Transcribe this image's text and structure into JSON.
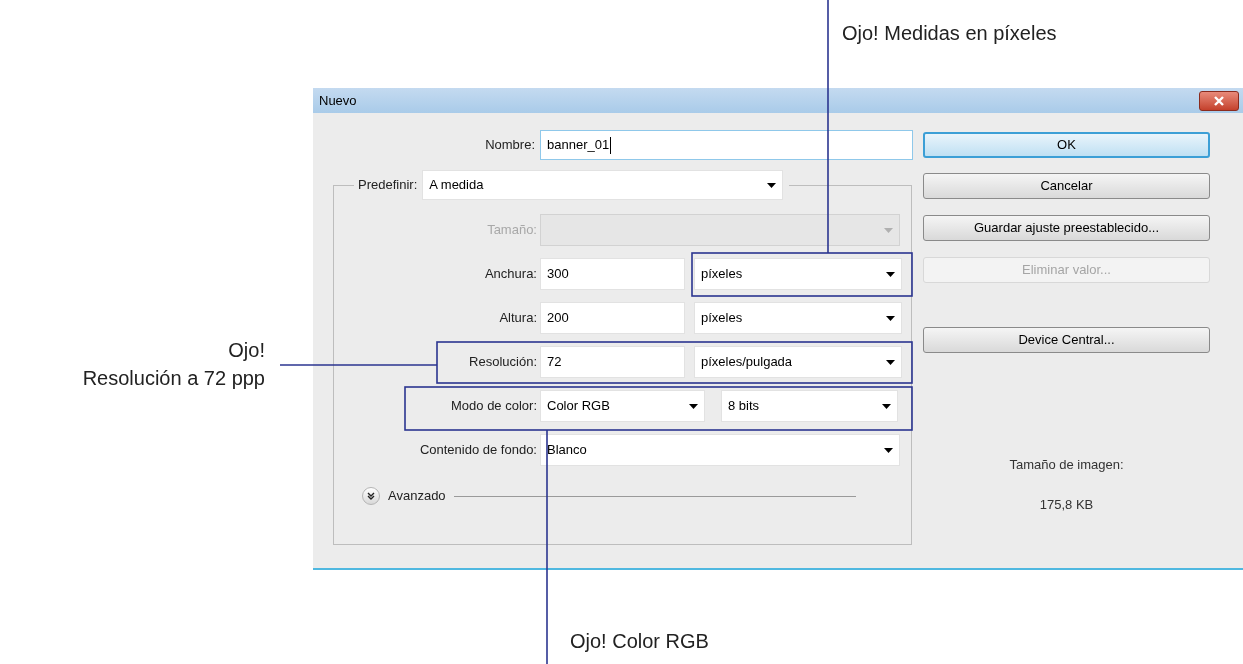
{
  "annotations": [
    {
      "text": "Ojo! Medidas en píxeles"
    },
    {
      "text": "Ojo!\nResolución a 72 ppp"
    },
    {
      "text": "Ojo! Color RGB"
    }
  ],
  "dialog": {
    "title": "Nuevo",
    "name_field": {
      "label": "Nombre:",
      "value": "banner_01",
      "focused": true
    },
    "preset": {
      "label": "Predefinir:",
      "value": "A medida"
    },
    "rows": [
      {
        "kind": "wide",
        "label": "Tamaño:",
        "disabled": true,
        "fields": [
          {
            "kind": "select"
          }
        ]
      },
      {
        "kind": "split",
        "label": "Anchura:",
        "disabled": false,
        "fields": [
          {
            "kind": "input",
            "value": "300"
          },
          {
            "kind": "select",
            "value": "píxeles"
          }
        ]
      },
      {
        "kind": "split",
        "label": "Altura:",
        "disabled": false,
        "fields": [
          {
            "kind": "input",
            "value": "200"
          },
          {
            "kind": "select",
            "value": "píxeles"
          }
        ]
      },
      {
        "kind": "split",
        "label": "Resolución:",
        "disabled": false,
        "fields": [
          {
            "kind": "input",
            "value": "72"
          },
          {
            "kind": "select",
            "value": "píxeles/pulgada"
          }
        ]
      },
      {
        "kind": "pair",
        "label": "Modo de color:",
        "disabled": false,
        "fields": [
          {
            "kind": "select",
            "value": "Color RGB"
          },
          {
            "kind": "select",
            "value": "8 bits"
          }
        ]
      },
      {
        "kind": "wide",
        "label": "Contenido de fondo:",
        "disabled": false,
        "fields": [
          {
            "kind": "select",
            "value": "Blanco"
          }
        ]
      }
    ],
    "advanced": {
      "label": "Avanzado",
      "expanded": false
    },
    "buttons": [
      {
        "label": "OK",
        "default": true,
        "disabled": false
      },
      {
        "label": "Cancelar",
        "default": false,
        "disabled": false
      },
      {
        "label": "Guardar ajuste preestablecido...",
        "default": false,
        "disabled": false
      },
      {
        "label": "Eliminar valor...",
        "default": false,
        "disabled": true
      },
      {
        "label": "Device Central...",
        "default": false,
        "disabled": false
      }
    ],
    "image_size": {
      "label": "Tamaño de imagen:",
      "value": "175,8 KB"
    }
  }
}
